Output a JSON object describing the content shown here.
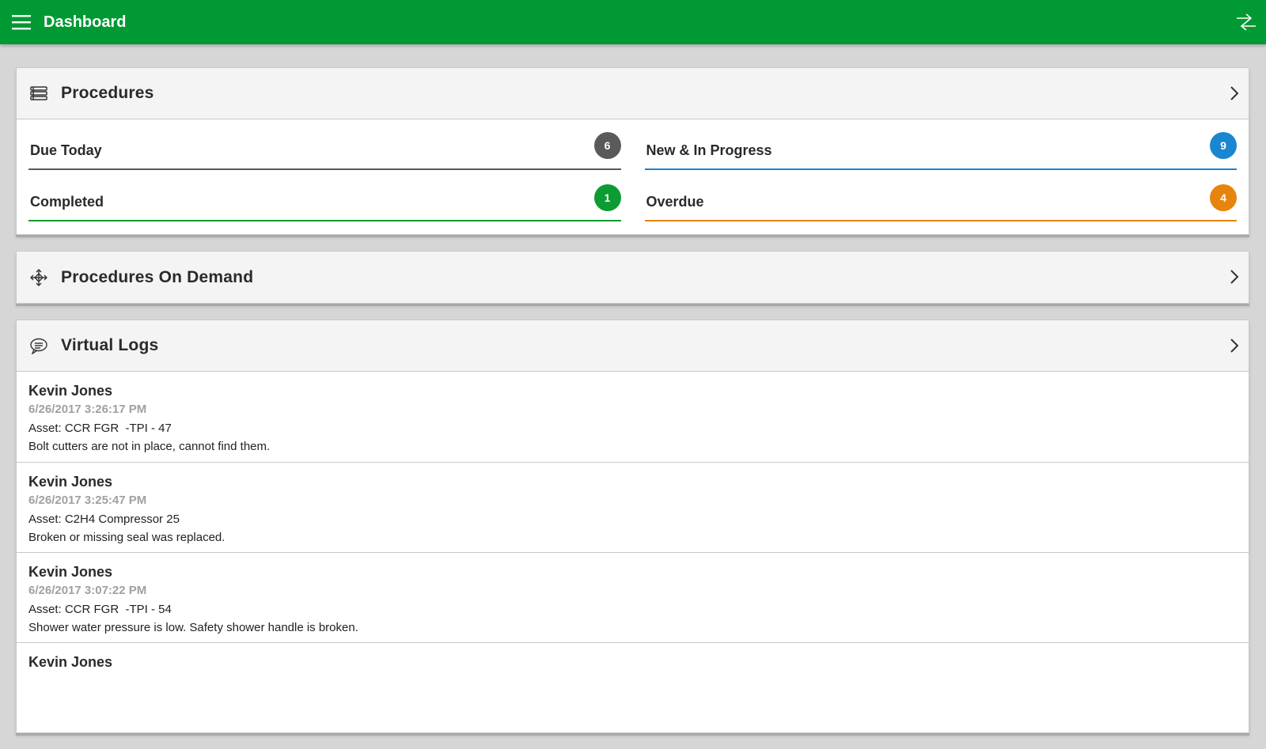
{
  "app": {
    "title": "Dashboard",
    "bar_color": "#009933"
  },
  "procedures": {
    "title": "Procedures",
    "icon": "list-icon",
    "stats": [
      {
        "label": "Due Today",
        "count": "6",
        "color": "#5a5a5a"
      },
      {
        "label": "New & In Progress",
        "count": "9",
        "color": "#1a86d0"
      },
      {
        "label": "Completed",
        "count": "1",
        "color": "#0d9b33"
      },
      {
        "label": "Overdue",
        "count": "4",
        "color": "#e6840d"
      }
    ]
  },
  "on_demand": {
    "title": "Procedures On Demand",
    "icon": "move-arrows-icon"
  },
  "virtual_logs": {
    "title": "Virtual Logs",
    "icon": "chat-icon",
    "entries": [
      {
        "name": "Kevin Jones",
        "date": "6/26/2017 3:26:17 PM",
        "asset": "Asset: CCR FGR  -TPI - 47",
        "message": "Bolt cutters are not in place, cannot find them."
      },
      {
        "name": "Kevin Jones",
        "date": "6/26/2017 3:25:47 PM",
        "asset": "Asset: C2H4 Compressor 25",
        "message": "Broken or missing seal was replaced."
      },
      {
        "name": "Kevin Jones",
        "date": "6/26/2017 3:07:22 PM",
        "asset": "Asset: CCR FGR  -TPI - 54",
        "message": "Shower water pressure is low. Safety shower handle is broken."
      },
      {
        "name": "Kevin Jones",
        "date": "",
        "asset": "",
        "message": ""
      }
    ]
  }
}
